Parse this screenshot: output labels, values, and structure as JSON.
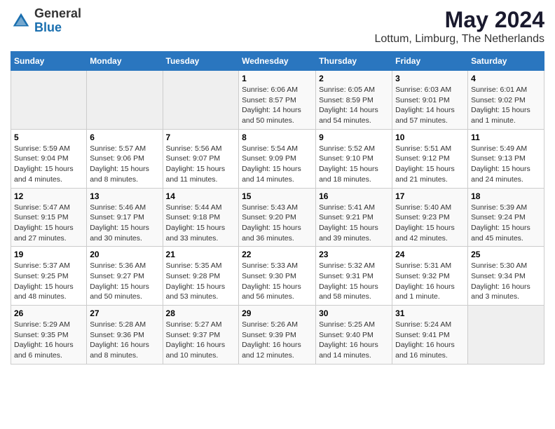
{
  "header": {
    "logo_general": "General",
    "logo_blue": "Blue",
    "title": "May 2024",
    "subtitle": "Lottum, Limburg, The Netherlands"
  },
  "weekdays": [
    "Sunday",
    "Monday",
    "Tuesday",
    "Wednesday",
    "Thursday",
    "Friday",
    "Saturday"
  ],
  "weeks": [
    [
      {
        "day": null
      },
      {
        "day": null
      },
      {
        "day": null
      },
      {
        "day": "1",
        "sunrise": "Sunrise: 6:06 AM",
        "sunset": "Sunset: 8:57 PM",
        "daylight": "Daylight: 14 hours and 50 minutes."
      },
      {
        "day": "2",
        "sunrise": "Sunrise: 6:05 AM",
        "sunset": "Sunset: 8:59 PM",
        "daylight": "Daylight: 14 hours and 54 minutes."
      },
      {
        "day": "3",
        "sunrise": "Sunrise: 6:03 AM",
        "sunset": "Sunset: 9:01 PM",
        "daylight": "Daylight: 14 hours and 57 minutes."
      },
      {
        "day": "4",
        "sunrise": "Sunrise: 6:01 AM",
        "sunset": "Sunset: 9:02 PM",
        "daylight": "Daylight: 15 hours and 1 minute."
      }
    ],
    [
      {
        "day": "5",
        "sunrise": "Sunrise: 5:59 AM",
        "sunset": "Sunset: 9:04 PM",
        "daylight": "Daylight: 15 hours and 4 minutes."
      },
      {
        "day": "6",
        "sunrise": "Sunrise: 5:57 AM",
        "sunset": "Sunset: 9:06 PM",
        "daylight": "Daylight: 15 hours and 8 minutes."
      },
      {
        "day": "7",
        "sunrise": "Sunrise: 5:56 AM",
        "sunset": "Sunset: 9:07 PM",
        "daylight": "Daylight: 15 hours and 11 minutes."
      },
      {
        "day": "8",
        "sunrise": "Sunrise: 5:54 AM",
        "sunset": "Sunset: 9:09 PM",
        "daylight": "Daylight: 15 hours and 14 minutes."
      },
      {
        "day": "9",
        "sunrise": "Sunrise: 5:52 AM",
        "sunset": "Sunset: 9:10 PM",
        "daylight": "Daylight: 15 hours and 18 minutes."
      },
      {
        "day": "10",
        "sunrise": "Sunrise: 5:51 AM",
        "sunset": "Sunset: 9:12 PM",
        "daylight": "Daylight: 15 hours and 21 minutes."
      },
      {
        "day": "11",
        "sunrise": "Sunrise: 5:49 AM",
        "sunset": "Sunset: 9:13 PM",
        "daylight": "Daylight: 15 hours and 24 minutes."
      }
    ],
    [
      {
        "day": "12",
        "sunrise": "Sunrise: 5:47 AM",
        "sunset": "Sunset: 9:15 PM",
        "daylight": "Daylight: 15 hours and 27 minutes."
      },
      {
        "day": "13",
        "sunrise": "Sunrise: 5:46 AM",
        "sunset": "Sunset: 9:17 PM",
        "daylight": "Daylight: 15 hours and 30 minutes."
      },
      {
        "day": "14",
        "sunrise": "Sunrise: 5:44 AM",
        "sunset": "Sunset: 9:18 PM",
        "daylight": "Daylight: 15 hours and 33 minutes."
      },
      {
        "day": "15",
        "sunrise": "Sunrise: 5:43 AM",
        "sunset": "Sunset: 9:20 PM",
        "daylight": "Daylight: 15 hours and 36 minutes."
      },
      {
        "day": "16",
        "sunrise": "Sunrise: 5:41 AM",
        "sunset": "Sunset: 9:21 PM",
        "daylight": "Daylight: 15 hours and 39 minutes."
      },
      {
        "day": "17",
        "sunrise": "Sunrise: 5:40 AM",
        "sunset": "Sunset: 9:23 PM",
        "daylight": "Daylight: 15 hours and 42 minutes."
      },
      {
        "day": "18",
        "sunrise": "Sunrise: 5:39 AM",
        "sunset": "Sunset: 9:24 PM",
        "daylight": "Daylight: 15 hours and 45 minutes."
      }
    ],
    [
      {
        "day": "19",
        "sunrise": "Sunrise: 5:37 AM",
        "sunset": "Sunset: 9:25 PM",
        "daylight": "Daylight: 15 hours and 48 minutes."
      },
      {
        "day": "20",
        "sunrise": "Sunrise: 5:36 AM",
        "sunset": "Sunset: 9:27 PM",
        "daylight": "Daylight: 15 hours and 50 minutes."
      },
      {
        "day": "21",
        "sunrise": "Sunrise: 5:35 AM",
        "sunset": "Sunset: 9:28 PM",
        "daylight": "Daylight: 15 hours and 53 minutes."
      },
      {
        "day": "22",
        "sunrise": "Sunrise: 5:33 AM",
        "sunset": "Sunset: 9:30 PM",
        "daylight": "Daylight: 15 hours and 56 minutes."
      },
      {
        "day": "23",
        "sunrise": "Sunrise: 5:32 AM",
        "sunset": "Sunset: 9:31 PM",
        "daylight": "Daylight: 15 hours and 58 minutes."
      },
      {
        "day": "24",
        "sunrise": "Sunrise: 5:31 AM",
        "sunset": "Sunset: 9:32 PM",
        "daylight": "Daylight: 16 hours and 1 minute."
      },
      {
        "day": "25",
        "sunrise": "Sunrise: 5:30 AM",
        "sunset": "Sunset: 9:34 PM",
        "daylight": "Daylight: 16 hours and 3 minutes."
      }
    ],
    [
      {
        "day": "26",
        "sunrise": "Sunrise: 5:29 AM",
        "sunset": "Sunset: 9:35 PM",
        "daylight": "Daylight: 16 hours and 6 minutes."
      },
      {
        "day": "27",
        "sunrise": "Sunrise: 5:28 AM",
        "sunset": "Sunset: 9:36 PM",
        "daylight": "Daylight: 16 hours and 8 minutes."
      },
      {
        "day": "28",
        "sunrise": "Sunrise: 5:27 AM",
        "sunset": "Sunset: 9:37 PM",
        "daylight": "Daylight: 16 hours and 10 minutes."
      },
      {
        "day": "29",
        "sunrise": "Sunrise: 5:26 AM",
        "sunset": "Sunset: 9:39 PM",
        "daylight": "Daylight: 16 hours and 12 minutes."
      },
      {
        "day": "30",
        "sunrise": "Sunrise: 5:25 AM",
        "sunset": "Sunset: 9:40 PM",
        "daylight": "Daylight: 16 hours and 14 minutes."
      },
      {
        "day": "31",
        "sunrise": "Sunrise: 5:24 AM",
        "sunset": "Sunset: 9:41 PM",
        "daylight": "Daylight: 16 hours and 16 minutes."
      },
      {
        "day": null
      }
    ]
  ]
}
